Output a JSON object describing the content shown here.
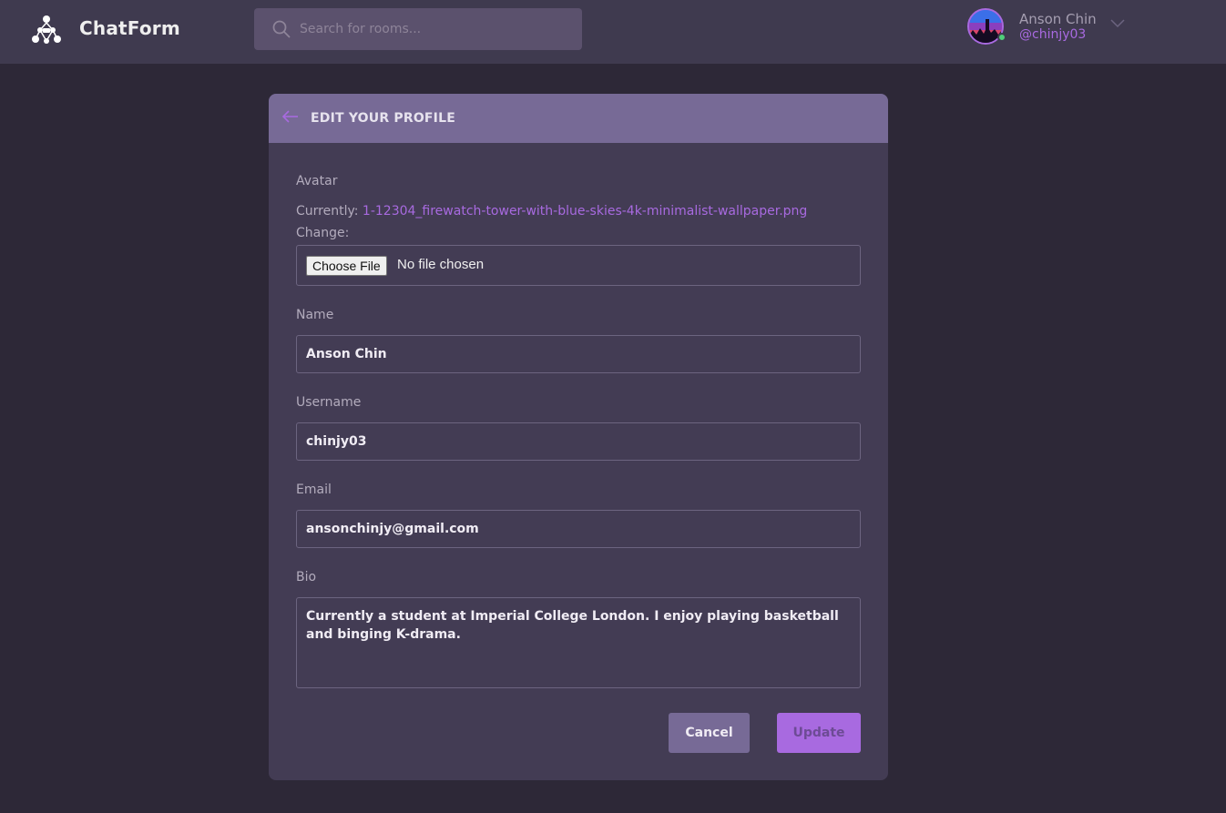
{
  "header": {
    "app_name": "ChatForm",
    "search_placeholder": "Search for rooms...",
    "user": {
      "name": "Anson Chin",
      "handle": "@chinjy03",
      "status": "online"
    }
  },
  "form": {
    "title": "EDIT YOUR PROFILE",
    "avatar": {
      "label": "Avatar",
      "currently_label": "Currently:",
      "current_file": "1-12304_firewatch-tower-with-blue-skies-4k-minimalist-wallpaper.png",
      "change_label": "Change:",
      "choose_button": "Choose File",
      "no_file_text": "No file chosen"
    },
    "name": {
      "label": "Name",
      "value": "Anson Chin"
    },
    "username": {
      "label": "Username",
      "value": "chinjy03"
    },
    "email": {
      "label": "Email",
      "value": "ansonchinjy@gmail.com"
    },
    "bio": {
      "label": "Bio",
      "value": "Currently a student at Imperial College London. I enjoy playing basketball and binging K-drama."
    },
    "cancel_label": "Cancel",
    "update_label": "Update"
  },
  "colors": {
    "accent": "#a86ae0",
    "header_bg": "#3f3a4f",
    "page_bg": "#2d2837",
    "card_bg": "#433c54",
    "card_header_bg": "#776a96",
    "online": "#4fd07a"
  }
}
